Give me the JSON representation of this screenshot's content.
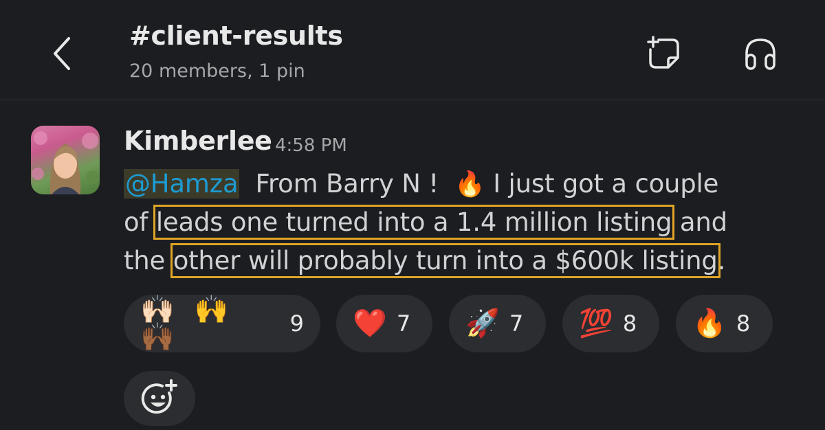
{
  "header": {
    "title": "#client-results",
    "subtitle": "20 members, 1 pin",
    "back_icon": "chevron-left-icon",
    "canvas_icon": "new-canvas-icon",
    "huddle_icon": "headphones-icon"
  },
  "message": {
    "author": "Kimberlee",
    "time": "4:58 PM",
    "mention": "@Hamza",
    "text_a": "  From Barry N !  ",
    "emoji_fire": "🔥",
    "text_b": " I just got a couple",
    "text_c": "of ",
    "highlight_1": "leads one turned into a 1.4 million listing",
    "text_d": " and",
    "text_e": "the ",
    "highlight_2": "other will probably turn into a $600k listing",
    "text_f": "."
  },
  "reactions": [
    {
      "emoji": "🙌🏻 🙌 🙌🏾",
      "count": "9"
    },
    {
      "emoji": "❤️",
      "count": "7"
    },
    {
      "emoji": "🚀",
      "count": "7"
    },
    {
      "emoji": "💯",
      "count": "8"
    },
    {
      "emoji": "🔥",
      "count": "8"
    }
  ],
  "add_reaction_icon": "add-reaction-icon",
  "colors": {
    "background": "#1b1d21",
    "mention": "#1d9bd1",
    "highlight_outline": "#e0a426",
    "pill": "#2b2d31"
  }
}
